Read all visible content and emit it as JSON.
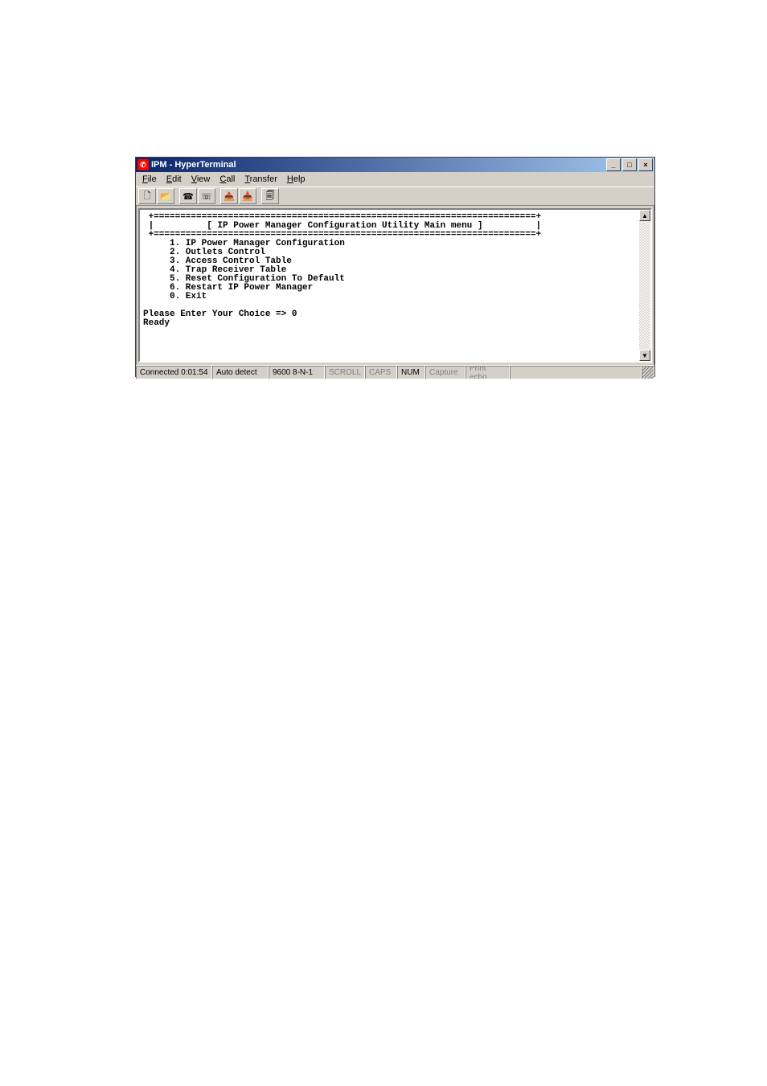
{
  "title": "IPM - HyperTerminal",
  "menu": {
    "file": "File",
    "edit": "Edit",
    "view": "View",
    "call": "Call",
    "transfer": "Transfer",
    "help": "Help"
  },
  "terminal": {
    "text": " +========================================================================+\n |          [ IP Power Manager Configuration Utility Main menu ]          |\n +========================================================================+\n     1. IP Power Manager Configuration\n     2. Outlets Control\n     3. Access Control Table\n     4. Trap Receiver Table\n     5. Reset Configuration To Default\n     6. Restart IP Power Manager\n     0. Exit\n\nPlease Enter Your Choice => 0\nReady"
  },
  "status": {
    "conn": "Connected 0:01:54",
    "auto": "Auto detect",
    "baud": "9600 8-N-1",
    "scroll": "SCROLL",
    "caps": "CAPS",
    "num": "NUM",
    "capture": "Capture",
    "echo": "Print echo"
  },
  "winbtn": {
    "min": "_",
    "max": "□",
    "close": "×"
  },
  "scroll": {
    "up": "▲",
    "down": "▼"
  }
}
